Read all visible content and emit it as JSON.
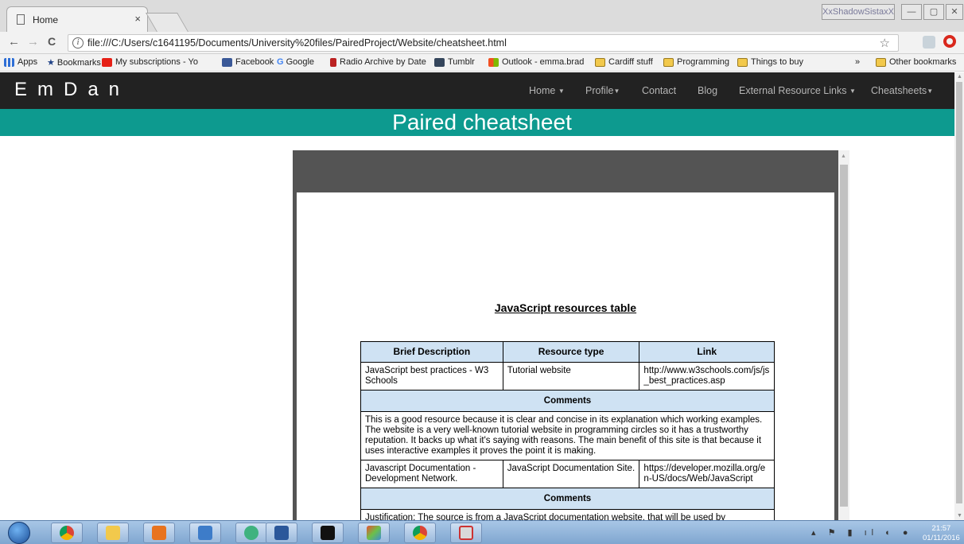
{
  "browser": {
    "tab_title": "Home",
    "tab_close": "×",
    "profile_name": "XxShadowSistaxX",
    "window_controls": [
      "—",
      "▢",
      "✕"
    ],
    "back": "←",
    "forward": "→",
    "reload": "C",
    "url": "file:///C:/Users/c1641195/Documents/University%20files/PairedProject/Website/cheatsheet.html",
    "bookmarks": [
      {
        "label": "Apps",
        "icon": "apps-grid-icon"
      },
      {
        "label": "Bookmarks",
        "icon": "star-icon"
      },
      {
        "label": "My subscriptions - Yo",
        "icon": "youtube-icon"
      },
      {
        "label": "Facebook",
        "icon": "facebook-icon"
      },
      {
        "label": "Google",
        "icon": "google-icon"
      },
      {
        "label": "Radio Archive by Date",
        "icon": "radio-icon"
      },
      {
        "label": "Tumblr",
        "icon": "tumblr-icon"
      },
      {
        "label": "Outlook - emma.brad",
        "icon": "outlook-icon"
      },
      {
        "label": "Cardiff stuff",
        "icon": "folder-icon"
      },
      {
        "label": "Programming",
        "icon": "folder-icon"
      },
      {
        "label": "Things to buy",
        "icon": "folder-icon"
      }
    ],
    "bookmarks_overflow": "»",
    "other_bookmarks": "Other bookmarks"
  },
  "site": {
    "brand": "EmDan",
    "nav": [
      {
        "label": "Home",
        "dropdown": true
      },
      {
        "label": "Profile",
        "dropdown": true
      },
      {
        "label": "Contact",
        "dropdown": false
      },
      {
        "label": "Blog",
        "dropdown": false
      },
      {
        "label": "External Resource Links",
        "dropdown": true
      },
      {
        "label": "Cheatsheets",
        "dropdown": true
      }
    ],
    "caret": "▼",
    "banner_title": "Paired cheatsheet",
    "colors": {
      "nav_bg": "#222222",
      "banner_bg": "#0d9a8f",
      "table_header_bg": "#cfe2f3"
    }
  },
  "document": {
    "title": "JavaScript resources table",
    "headers": [
      "Brief Description",
      "Resource type",
      "Link"
    ],
    "comments_label": "Comments",
    "rows": [
      {
        "description": "JavaScript best practices - W3 Schools",
        "type": "Tutorial website",
        "link": "http://www.w3schools.com/js/js_best_practices.asp",
        "comment": "This is a good resource because it is clear and concise in its explanation which working examples. The website is a very well-known tutorial website in programming circles so it has a trustworthy reputation. It backs up what it's saying with reasons. The main benefit of this site is that because it uses interactive examples it proves the point it is making."
      },
      {
        "description": "Javascript Documentation - Development Network.",
        "type": "JavaScript Documentation Site.",
        "link": "https://developer.mozilla.org/en-US/docs/Web/JavaScript",
        "comment": "Justification: The source is from a JavaScript documentation website, that will be used by"
      }
    ]
  },
  "taskbar": {
    "apps": [
      "chrome-icon",
      "file-explorer-icon",
      "media-player-icon",
      "image-viewer-icon",
      "atom-icon",
      "word-icon",
      "command-prompt-icon",
      "git-icon",
      "chrome-icon",
      "snipping-tool-icon"
    ],
    "time": "21:57",
    "date": "01/11/2016"
  }
}
